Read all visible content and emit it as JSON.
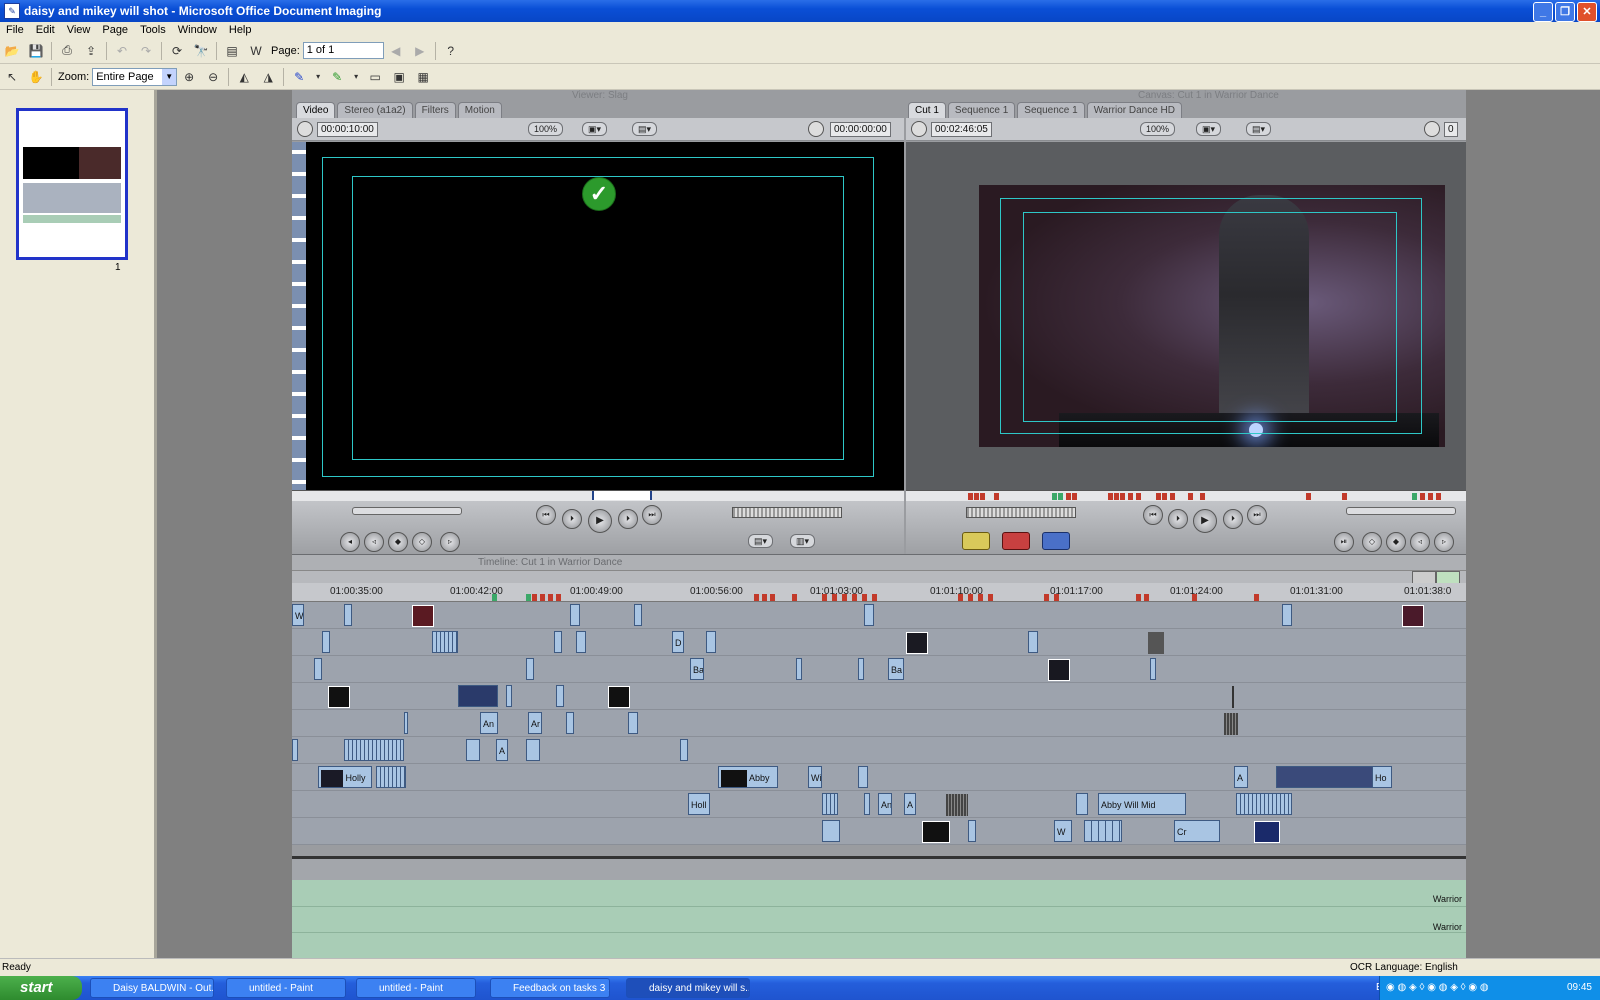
{
  "window": {
    "title": "daisy and mikey will shot - Microsoft Office Document Imaging"
  },
  "menu": [
    "File",
    "Edit",
    "View",
    "Page",
    "Tools",
    "Window",
    "Help"
  ],
  "toolbar": {
    "page_label": "Page:",
    "page_value": "1 of 1",
    "zoom_label": "Zoom:",
    "zoom_value": "Entire Page"
  },
  "thumbnail": {
    "page_number": "1"
  },
  "viewer": {
    "title": "Viewer: Slag",
    "tabs": [
      "Video",
      "Stereo (a1a2)",
      "Filters",
      "Motion"
    ],
    "duration": "00:00:10:00",
    "current_time": "00:00:00:00",
    "zoom": "100%"
  },
  "canvas": {
    "title": "Canvas: Cut 1 in Warrior Dance",
    "tabs": [
      "Cut 1",
      "Sequence 1",
      "Sequence 1",
      "Warrior Dance HD"
    ],
    "duration": "00:02:46:05",
    "zoom": "100%",
    "current_time_partial": "0"
  },
  "timeline": {
    "title": "Timeline: Cut 1 in Warrior Dance",
    "ruler": [
      "01:00:35:00",
      "01:00:42:00",
      "01:00:49:00",
      "01:00:56:00",
      "01:01:03:00",
      "01:01:10:00",
      "01:01:17:00",
      "01:01:24:00",
      "01:01:31:00",
      "01:01:38:0"
    ],
    "clip_labels": {
      "holly": "Holly",
      "abby": "Abby",
      "holl": "Holl",
      "abby_will": "Abby  Will Mid",
      "ba": "Ba",
      "an": "An",
      "ar": "Ar",
      "a": "A",
      "wi": "Wi",
      "ho": "Ho",
      "cr": "Cr",
      "d": "D",
      "w": "W"
    },
    "audio_labels": [
      "Warrior",
      "Warrior"
    ]
  },
  "status": {
    "left": "Ready",
    "right": "OCR Language: English"
  },
  "taskbar": {
    "start": "start",
    "items": [
      "Daisy BALDWIN - Out...",
      "untitled - Paint",
      "untitled - Paint",
      "Feedback on tasks 3 ...",
      "daisy and mikey will s..."
    ],
    "lang": "EN",
    "clock": "09:45"
  }
}
